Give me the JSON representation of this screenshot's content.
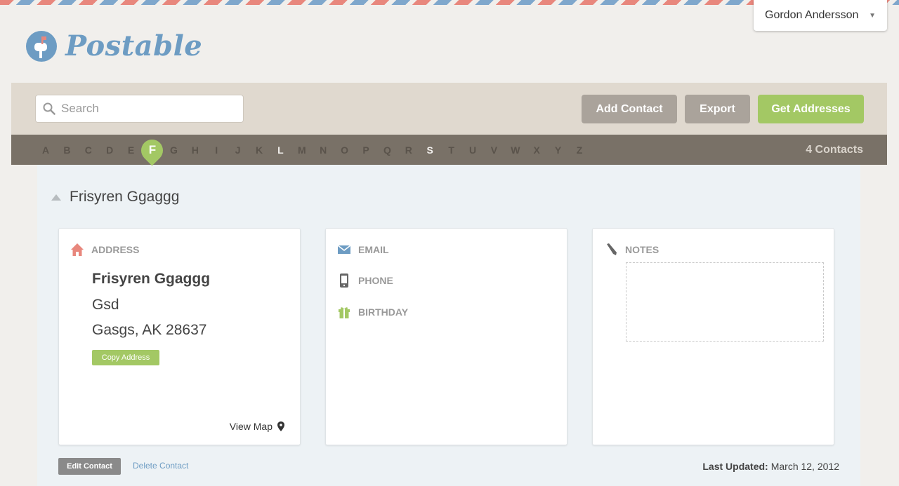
{
  "user": {
    "name": "Gordon Andersson"
  },
  "app": {
    "name": "Postable"
  },
  "toolbar": {
    "search_placeholder": "Search",
    "add_contact": "Add Contact",
    "export": "Export",
    "get_addresses": "Get Addresses"
  },
  "alphabet": {
    "letters": [
      "A",
      "B",
      "C",
      "D",
      "E",
      "F",
      "G",
      "H",
      "I",
      "J",
      "K",
      "L",
      "M",
      "N",
      "O",
      "P",
      "Q",
      "R",
      "S",
      "T",
      "U",
      "V",
      "W",
      "X",
      "Y",
      "Z"
    ],
    "active": "F",
    "highlighted": [
      "L",
      "S"
    ],
    "count_label": "4 Contacts"
  },
  "contact": {
    "name": "Frisyren Ggaggg",
    "address": {
      "label": "ADDRESS",
      "name": "Frisyren Ggaggg",
      "line1": "Gsd",
      "line2": "Gasgs, AK 28637",
      "copy_label": "Copy Address",
      "view_map": "View Map"
    },
    "email_label": "EMAIL",
    "phone_label": "PHONE",
    "birthday_label": "BIRTHDAY",
    "notes_label": "NOTES",
    "edit_label": "Edit Contact",
    "delete_label": "Delete Contact",
    "last_updated_label": "Last Updated:",
    "last_updated_value": "March 12, 2012"
  },
  "colors": {
    "brand_blue": "#6d9cc3",
    "accent_green": "#a3c864",
    "accent_red": "#e8877d",
    "toolbar_bg": "#e0d9cf",
    "alpha_bg": "#797167"
  }
}
